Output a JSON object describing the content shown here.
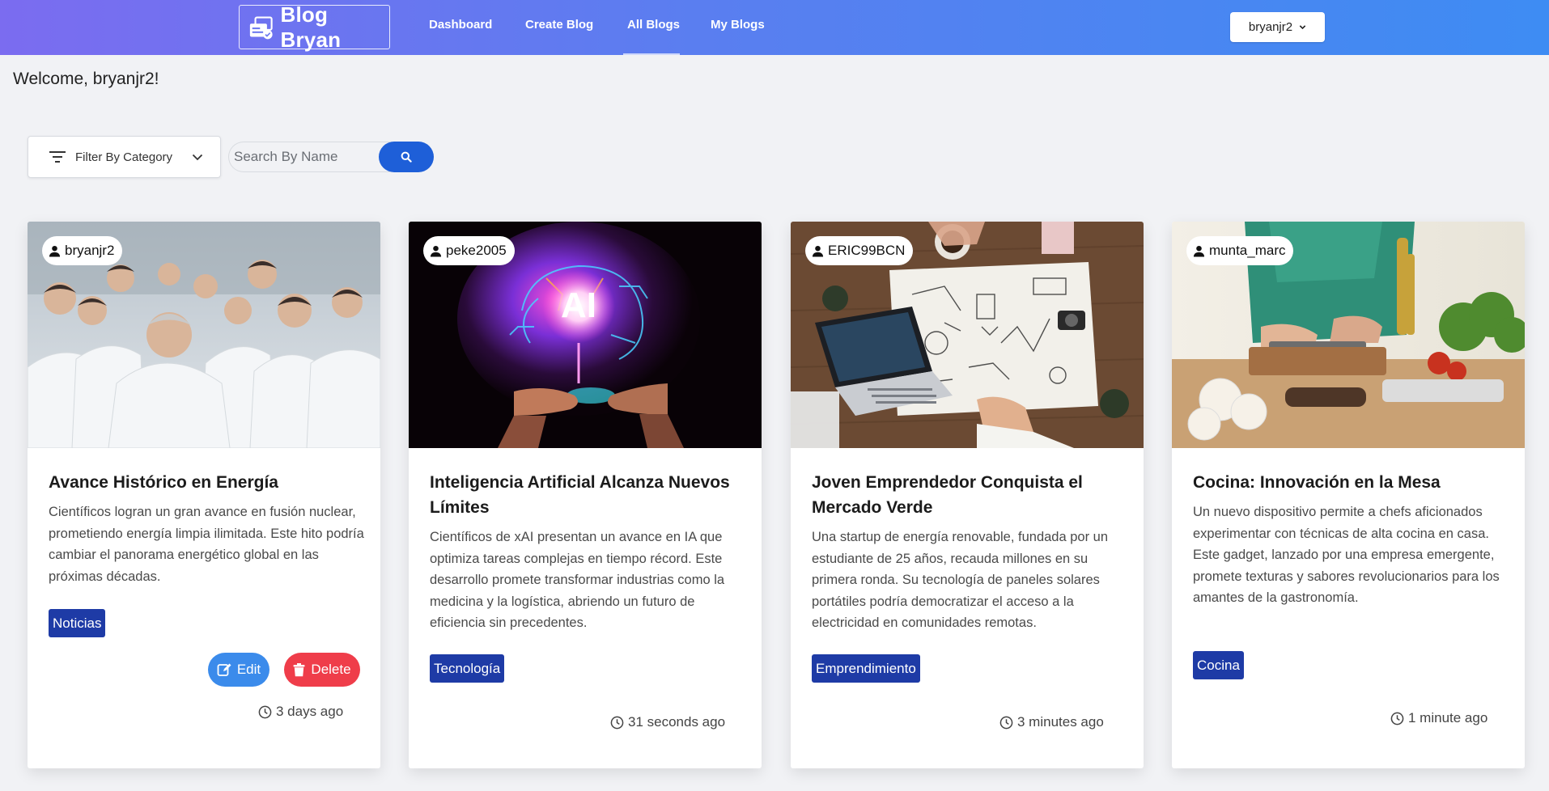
{
  "nav": {
    "brand": "Blog Bryan",
    "links": [
      "Dashboard",
      "Create Blog",
      "All Blogs",
      "My Blogs"
    ],
    "active": "All Blogs",
    "user": "bryanjr2"
  },
  "welcome": "Welcome, bryanjr2!",
  "filter": {
    "label": "Filter By Category"
  },
  "search": {
    "placeholder": "Search By Name",
    "value": ""
  },
  "cards": [
    {
      "author": "bryanjr2",
      "title": "Avance Histórico en Energía",
      "body": "Científicos logran un gran avance en fusión nuclear, prometiendo energía limpia ilimitada. Este hito podría cambiar el panorama energético global en las próximas décadas.",
      "tag": "Noticias",
      "time": "3 days ago",
      "edit": "Edit",
      "delete": "Delete",
      "image": "scientists-lab-coats"
    },
    {
      "author": "peke2005",
      "title": "Inteligencia Artificial Alcanza Nuevos Límites",
      "body": "Científicos de xAI presentan un avance en IA que optimiza tareas complejas en tiempo récord. Este desarrollo promete transformar industrias como la medicina y la logística, abriendo un futuro de eficiencia sin precedentes.",
      "tag": "Tecnología",
      "time": "31 seconds ago",
      "image_text": "AI",
      "image": "ai-brain-hands"
    },
    {
      "author": "ERIC99BCN",
      "title": "Joven Emprendedor Conquista el Mercado Verde",
      "body": "Una startup de energía renovable, fundada por un estudiante de 25 años, recauda millones en su primera ronda. Su tecnología de paneles solares portátiles podría democratizar el acceso a la electricidad en comunidades remotas.",
      "tag": "Emprendimiento",
      "time": "3 minutes ago",
      "image": "business-desk-laptop"
    },
    {
      "author": "munta_marc",
      "title": "Cocina: Innovación en la Mesa",
      "body": "Un nuevo dispositivo permite a chefs aficionados experimentar con técnicas de alta cocina en casa. Este gadget, lanzado por una empresa emergente, promete texturas y sabores revolucionarios para los amantes de la gastronomía.",
      "tag": "Cocina",
      "time": "1 minute ago",
      "image": "kitchen-cooking"
    }
  ],
  "colors": {
    "accent": "#1e5fd8",
    "tag": "#1e3ba6",
    "edit": "#3b8beb",
    "delete": "#ef3d4a"
  }
}
